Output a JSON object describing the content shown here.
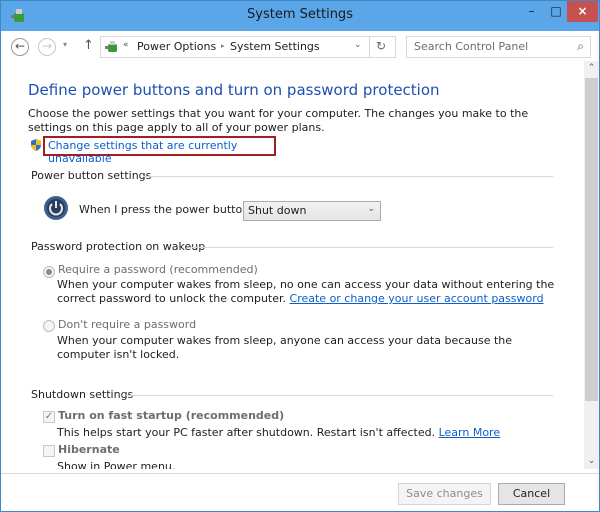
{
  "window": {
    "title": "System Settings",
    "controls": {
      "minimize": "–",
      "maximize": "□",
      "close": "×"
    }
  },
  "nav": {
    "back_icon": "←",
    "forward_icon": "→",
    "recent_icon": "▾",
    "up_icon": "↑",
    "breadcrumb": {
      "overflow": "«",
      "items": [
        "Power Options",
        "System Settings"
      ],
      "separator": "▸"
    },
    "address_dropdown": "⌄",
    "refresh_icon": "↻",
    "search": {
      "placeholder": "Search Control Panel",
      "icon": "⌕"
    }
  },
  "main": {
    "heading": "Define power buttons and turn on password protection",
    "intro": "Choose the power settings that you want for your computer. The changes you make to the settings on this page apply to all of your power plans.",
    "change_link": "Change settings that are currently unavailable",
    "power_section": {
      "label": "Power button settings",
      "press_label": "When I press the power button:",
      "selected": "Shut down"
    },
    "password_section": {
      "label": "Password protection on wakeup",
      "options": [
        {
          "label": "Require a password (recommended)",
          "selected": true,
          "desc": "When your computer wakes from sleep, no one can access your data without entering the correct password to unlock the computer.",
          "link": "Create or change your user account password"
        },
        {
          "label": "Don't require a password",
          "selected": false,
          "desc": "When your computer wakes from sleep, anyone can access your data because the computer isn't locked."
        }
      ]
    },
    "shutdown_section": {
      "label": "Shutdown settings",
      "items": [
        {
          "label": "Turn on fast startup (recommended)",
          "checked": true,
          "desc": "This helps start your PC faster after shutdown. Restart isn't affected.",
          "link": "Learn More"
        },
        {
          "label": "Hibernate",
          "checked": false,
          "desc": "Show in Power menu."
        }
      ]
    }
  },
  "scrollbar": {
    "up": "⌃",
    "down": "⌄"
  },
  "footer": {
    "save": "Save changes",
    "cancel": "Cancel"
  }
}
